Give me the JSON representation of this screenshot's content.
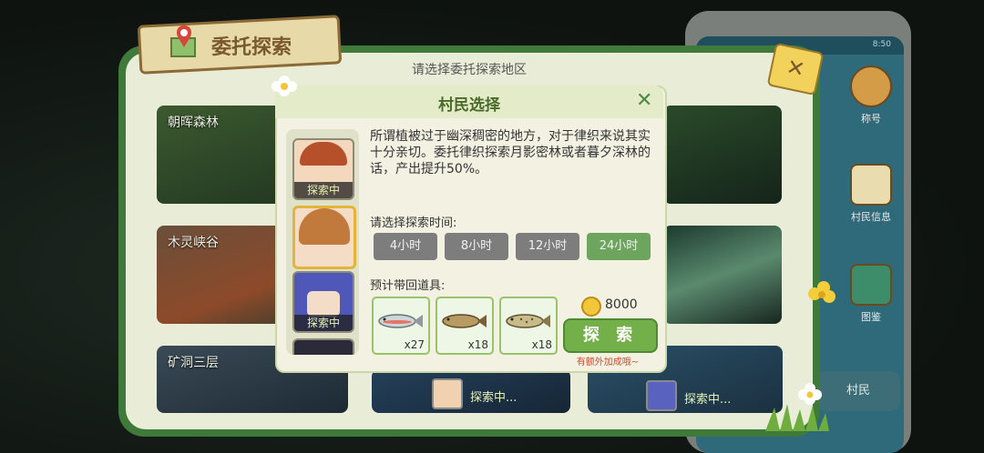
{
  "header": {
    "title": "委托探索",
    "subtitle": "请选择委托探索地区"
  },
  "areas": [
    {
      "name": "朝晖森林"
    },
    {
      "name": "木灵峡谷"
    },
    {
      "name": "矿洞三层"
    }
  ],
  "bottom_status": [
    {
      "label": "探索中..."
    },
    {
      "label": "探索中..."
    }
  ],
  "side_panel": {
    "time": "8:50",
    "items": [
      {
        "label": "称号",
        "icon": "badge-icon"
      },
      {
        "label": "村民信息",
        "icon": "profile-card-icon"
      },
      {
        "label": "图鉴",
        "icon": "book-icon"
      }
    ],
    "village_tab": "村民"
  },
  "dialog": {
    "title": "村民选择",
    "close": "✕",
    "villagers": [
      {
        "status": "探索中"
      },
      {
        "status": ""
      },
      {
        "status": "探索中"
      },
      {
        "status": ""
      }
    ],
    "description": "所谓植被过于幽深稠密的地方，对于律织来说其实十分亲切。委托律织探索月影密林或者暮夕深林的话，产出提升50%。",
    "time_label": "请选择探索时间:",
    "time_options": [
      "4小时",
      "8小时",
      "12小时",
      "24小时"
    ],
    "selected_time": "24小时",
    "items_label": "预计带回道具:",
    "items": [
      {
        "name": "fish-red",
        "count": "x27"
      },
      {
        "name": "fish-brown",
        "count": "x18"
      },
      {
        "name": "fish-spotted",
        "count": "x18"
      }
    ],
    "cost": "8000",
    "explore_button": "探 索",
    "bonus_note": "有额外加成哦~"
  },
  "colors": {
    "accent": "#6ea55e",
    "frame": "#3f7a3a",
    "warning": "#d04b2b"
  }
}
